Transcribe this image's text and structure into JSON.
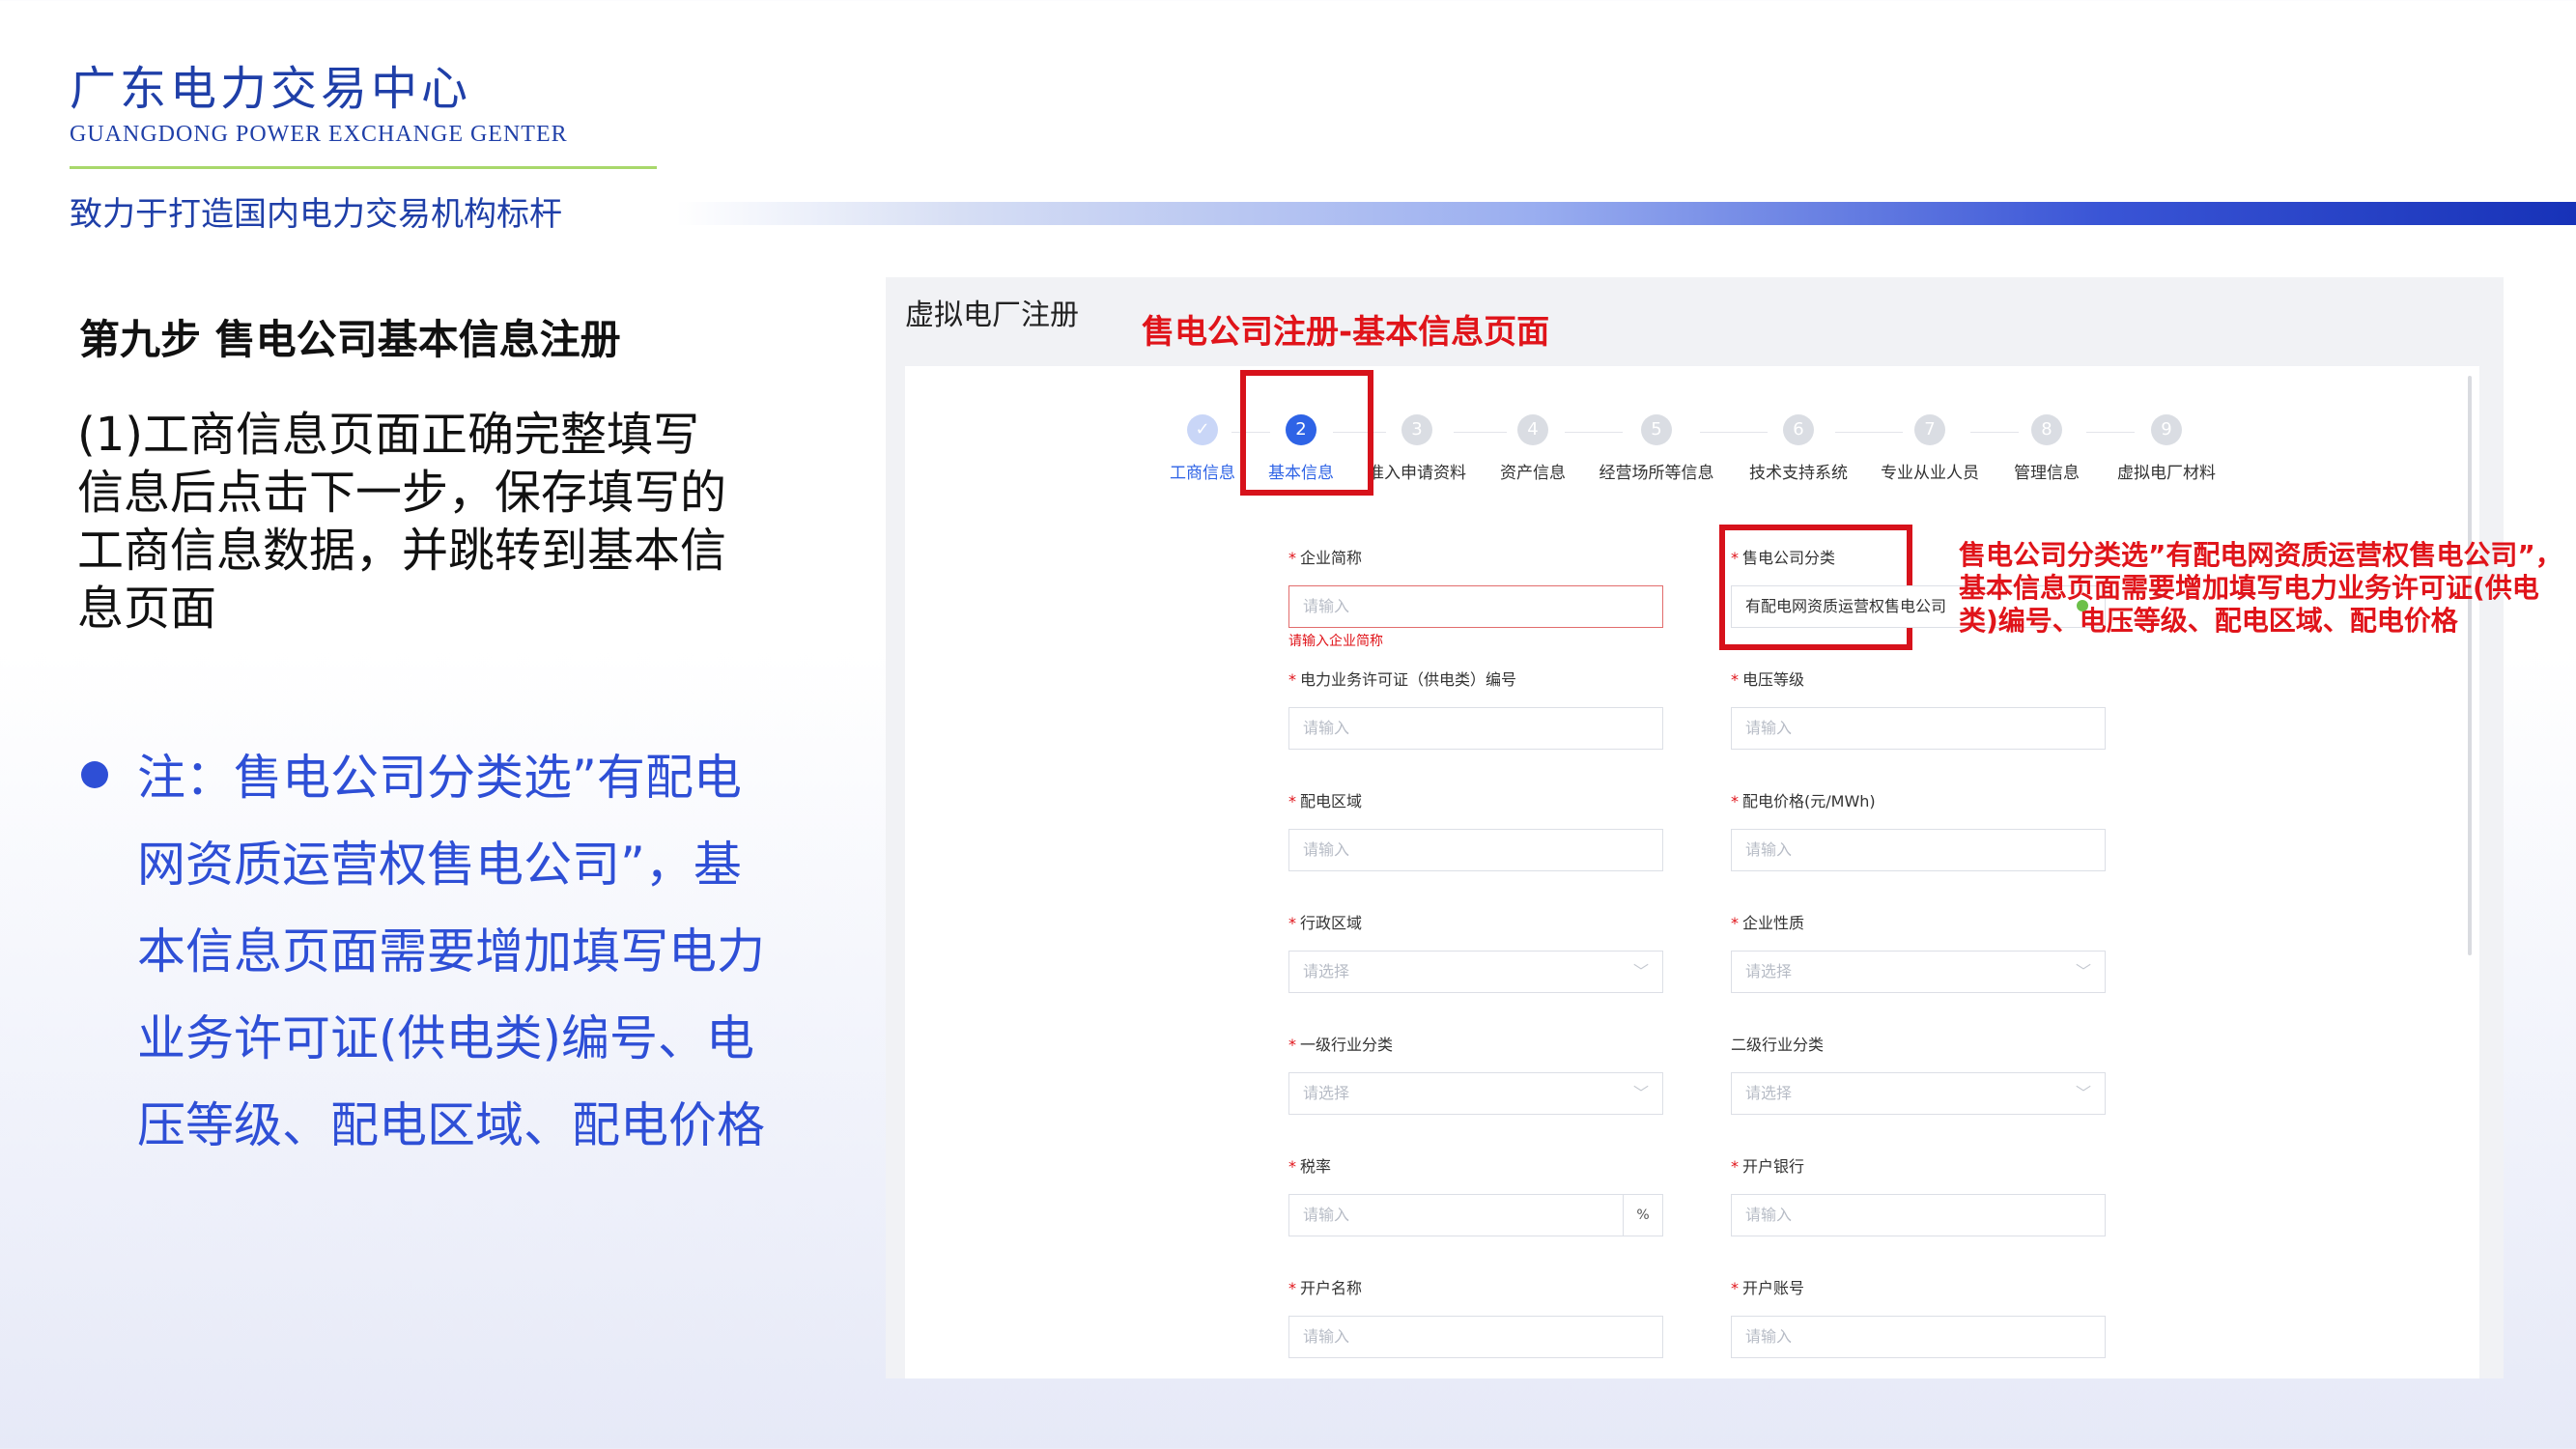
{
  "header": {
    "title": "广东电力交易中心",
    "english": "GUANGDONG POWER EXCHANGE GENTER",
    "slogan": "致力于打造国内电力交易机构标杆"
  },
  "left": {
    "step_title": "第九步 售电公司基本信息注册",
    "description": "(1)工商信息页面正确完整填写信息后点击下一步，保存填写的工商信息数据，并跳转到基本信息页面",
    "note": "注：售电公司分类选”有配电网资质运营权售电公司”，基本信息页面需要增加填写电力业务许可证(供电类)编号、电压等级、配电区域、配电价格"
  },
  "panel": {
    "title": "虚拟电厂注册",
    "overlay_heading": "售电公司注册-基本信息页面",
    "annotation": "售电公司分类选”有配电网资质运营权售电公司”，基本信息页面需要增加填写电力业务许可证(供电类)编号、电压等级、配电区域、配电价格"
  },
  "steps": [
    {
      "num": "✓",
      "label": "工商信息",
      "state": "done"
    },
    {
      "num": "2",
      "label": "基本信息",
      "state": "active"
    },
    {
      "num": "3",
      "label": "准入申请资料",
      "state": "todo"
    },
    {
      "num": "4",
      "label": "资产信息",
      "state": "todo"
    },
    {
      "num": "5",
      "label": "经营场所等信息",
      "state": "todo"
    },
    {
      "num": "6",
      "label": "技术支持系统",
      "state": "todo"
    },
    {
      "num": "7",
      "label": "专业从业人员",
      "state": "todo"
    },
    {
      "num": "8",
      "label": "管理信息",
      "state": "todo"
    },
    {
      "num": "9",
      "label": "虚拟电厂材料",
      "state": "todo"
    }
  ],
  "form": {
    "short_name": {
      "label": "企业简称",
      "placeholder": "请输入",
      "error": "请输入企业简称"
    },
    "company_type": {
      "label": "售电公司分类",
      "value": "有配电网资质运营权售电公司"
    },
    "license_no": {
      "label": "电力业务许可证（供电类）编号",
      "placeholder": "请输入"
    },
    "voltage": {
      "label": "电压等级",
      "placeholder": "请输入"
    },
    "dist_area": {
      "label": "配电区域",
      "placeholder": "请输入"
    },
    "dist_price": {
      "label": "配电价格(元/MWh)",
      "placeholder": "请输入"
    },
    "admin_area": {
      "label": "行政区域",
      "placeholder": "请选择"
    },
    "nature": {
      "label": "企业性质",
      "placeholder": "请选择"
    },
    "industry1": {
      "label": "一级行业分类",
      "placeholder": "请选择"
    },
    "industry2": {
      "label": "二级行业分类",
      "placeholder": "请选择"
    },
    "tax": {
      "label": "税率",
      "placeholder": "请输入",
      "suffix": "%"
    },
    "bank": {
      "label": "开户银行",
      "placeholder": "请输入"
    },
    "account_name": {
      "label": "开户名称",
      "placeholder": "请输入"
    },
    "account_no": {
      "label": "开户账号",
      "placeholder": "请输入"
    }
  },
  "colors": {
    "brand_blue": "#1f3fa8",
    "accent_red": "#e0141a",
    "step_active": "#2e63e6"
  }
}
